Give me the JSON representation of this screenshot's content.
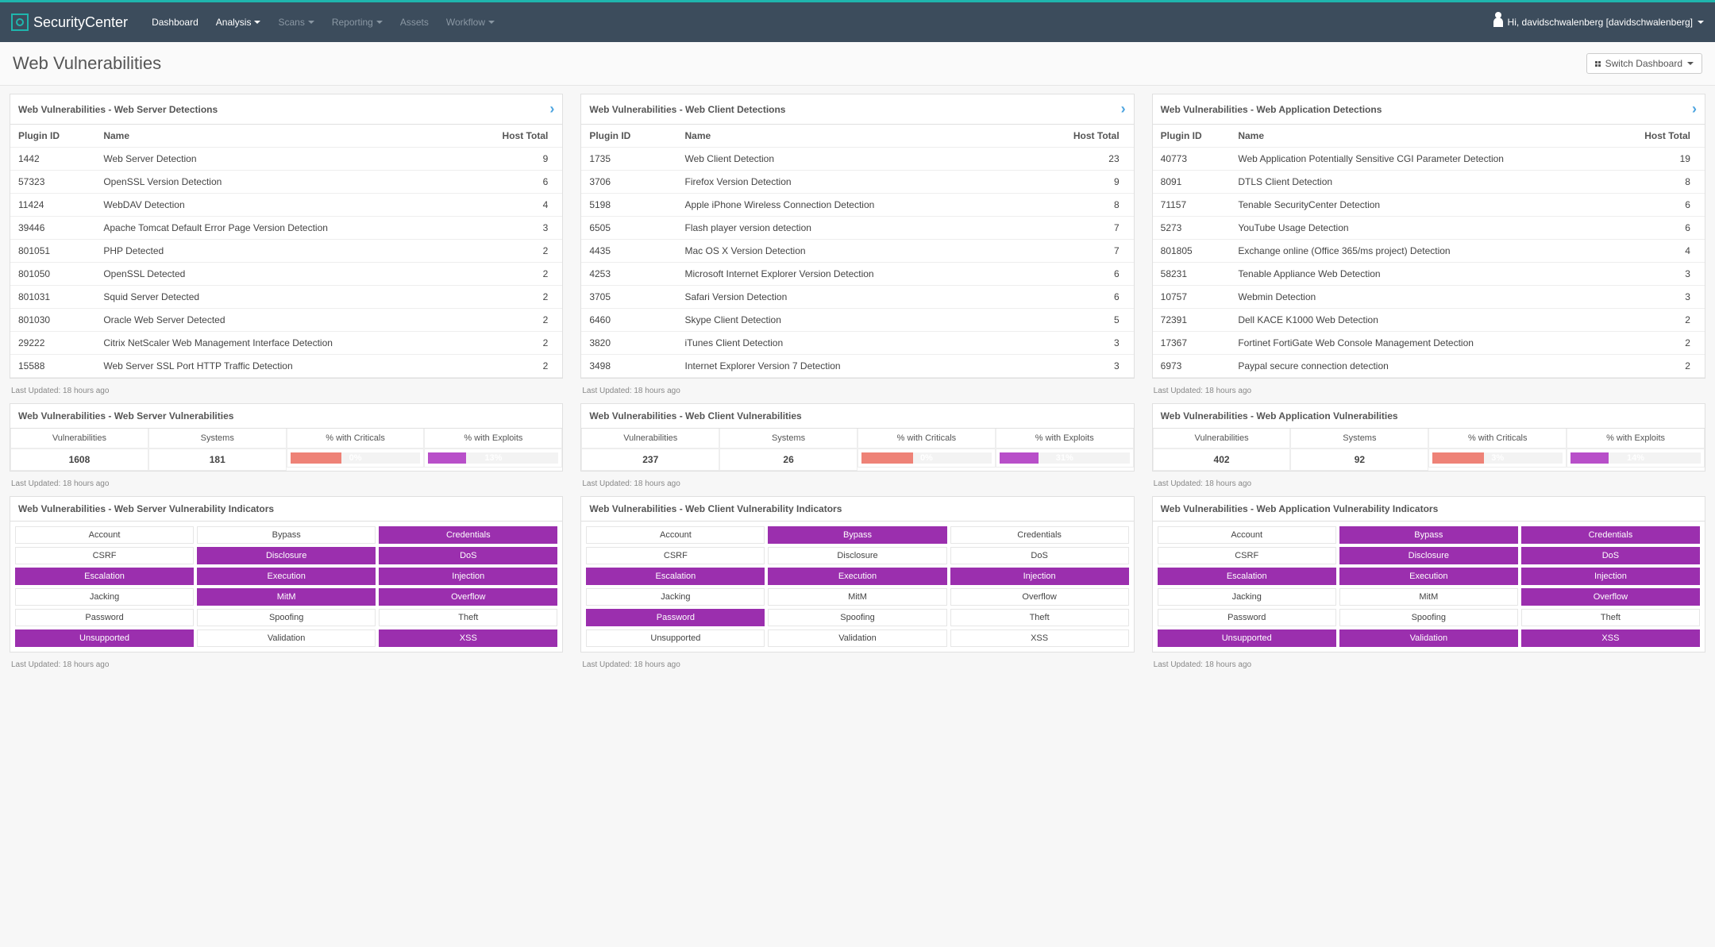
{
  "brand": "SecurityCenter",
  "nav": [
    {
      "label": "Dashboard",
      "active": true,
      "caret": false
    },
    {
      "label": "Analysis",
      "active": true,
      "caret": true
    },
    {
      "label": "Scans",
      "active": false,
      "caret": true
    },
    {
      "label": "Reporting",
      "active": false,
      "caret": true
    },
    {
      "label": "Assets",
      "active": false,
      "caret": false
    },
    {
      "label": "Workflow",
      "active": false,
      "caret": true
    }
  ],
  "user_greeting": "Hi, davidschwalenberg [davidschwalenberg]",
  "page_title": "Web Vulnerabilities",
  "switch_label": "Switch Dashboard",
  "updated_text": "Last Updated: 18 hours ago",
  "table_headers": {
    "plugin": "Plugin ID",
    "name": "Name",
    "host": "Host Total"
  },
  "detections": [
    {
      "title": "Web Vulnerabilities - Web Server Detections",
      "rows": [
        {
          "id": "1442",
          "name": "Web Server Detection",
          "total": "9"
        },
        {
          "id": "57323",
          "name": "OpenSSL Version Detection",
          "total": "6"
        },
        {
          "id": "11424",
          "name": "WebDAV Detection",
          "total": "4"
        },
        {
          "id": "39446",
          "name": "Apache Tomcat Default Error Page Version Detection",
          "total": "3"
        },
        {
          "id": "801051",
          "name": "PHP Detected",
          "total": "2"
        },
        {
          "id": "801050",
          "name": "OpenSSL Detected",
          "total": "2"
        },
        {
          "id": "801031",
          "name": "Squid Server Detected",
          "total": "2"
        },
        {
          "id": "801030",
          "name": "Oracle Web Server Detected",
          "total": "2"
        },
        {
          "id": "29222",
          "name": "Citrix NetScaler Web Management Interface Detection",
          "total": "2"
        },
        {
          "id": "15588",
          "name": "Web Server SSL Port HTTP Traffic Detection",
          "total": "2"
        }
      ]
    },
    {
      "title": "Web Vulnerabilities - Web Client Detections",
      "rows": [
        {
          "id": "1735",
          "name": "Web Client Detection",
          "total": "23"
        },
        {
          "id": "3706",
          "name": "Firefox Version Detection",
          "total": "9"
        },
        {
          "id": "5198",
          "name": "Apple iPhone Wireless Connection Detection",
          "total": "8"
        },
        {
          "id": "6505",
          "name": "Flash player version detection",
          "total": "7"
        },
        {
          "id": "4435",
          "name": "Mac OS X Version Detection",
          "total": "7"
        },
        {
          "id": "4253",
          "name": "Microsoft Internet Explorer Version Detection",
          "total": "6"
        },
        {
          "id": "3705",
          "name": "Safari Version Detection",
          "total": "6"
        },
        {
          "id": "6460",
          "name": "Skype Client Detection",
          "total": "5"
        },
        {
          "id": "3820",
          "name": "iTunes Client Detection",
          "total": "3"
        },
        {
          "id": "3498",
          "name": "Internet Explorer Version 7 Detection",
          "total": "3"
        }
      ]
    },
    {
      "title": "Web Vulnerabilities - Web Application Detections",
      "rows": [
        {
          "id": "40773",
          "name": "Web Application Potentially Sensitive CGI Parameter Detection",
          "total": "19"
        },
        {
          "id": "8091",
          "name": "DTLS Client Detection",
          "total": "8"
        },
        {
          "id": "71157",
          "name": "Tenable SecurityCenter Detection",
          "total": "6"
        },
        {
          "id": "5273",
          "name": "YouTube Usage Detection",
          "total": "6"
        },
        {
          "id": "801805",
          "name": "Exchange online (Office 365/ms project) Detection",
          "total": "4"
        },
        {
          "id": "58231",
          "name": "Tenable Appliance Web Detection",
          "total": "3"
        },
        {
          "id": "10757",
          "name": "Webmin Detection",
          "total": "3"
        },
        {
          "id": "72391",
          "name": "Dell KACE K1000 Web Detection",
          "total": "2"
        },
        {
          "id": "17367",
          "name": "Fortinet FortiGate Web Console Management Detection",
          "total": "2"
        },
        {
          "id": "6973",
          "name": "Paypal secure connection detection",
          "total": "2"
        }
      ]
    }
  ],
  "vuln_headers": [
    "Vulnerabilities",
    "Systems",
    "% with Criticals",
    "% with Exploits"
  ],
  "vulns": [
    {
      "title": "Web Vulnerabilities - Web Server Vulnerabilities",
      "vulns": "1608",
      "systems": "181",
      "crit_pct": 0,
      "crit_label": "0%",
      "exp_pct": 13,
      "exp_label": "13%"
    },
    {
      "title": "Web Vulnerabilities - Web Client Vulnerabilities",
      "vulns": "237",
      "systems": "26",
      "crit_pct": 0,
      "crit_label": "0%",
      "exp_pct": 31,
      "exp_label": "31%"
    },
    {
      "title": "Web Vulnerabilities - Web Application Vulnerabilities",
      "vulns": "402",
      "systems": "92",
      "crit_pct": 3,
      "crit_label": "3%",
      "exp_pct": 14,
      "exp_label": "14%"
    }
  ],
  "indicator_labels": [
    "Account",
    "Bypass",
    "Credentials",
    "CSRF",
    "Disclosure",
    "DoS",
    "Escalation",
    "Execution",
    "Injection",
    "Jacking",
    "MitM",
    "Overflow",
    "Password",
    "Spoofing",
    "Theft",
    "Unsupported",
    "Validation",
    "XSS"
  ],
  "indicators": [
    {
      "title": "Web Vulnerabilities - Web Server Vulnerability Indicators",
      "on": [
        2,
        4,
        5,
        6,
        7,
        8,
        10,
        11,
        15,
        17
      ]
    },
    {
      "title": "Web Vulnerabilities - Web Client Vulnerability Indicators",
      "on": [
        1,
        6,
        7,
        8,
        12
      ]
    },
    {
      "title": "Web Vulnerabilities - Web Application Vulnerability Indicators",
      "on": [
        1,
        2,
        4,
        5,
        6,
        7,
        8,
        11,
        15,
        16,
        17
      ]
    }
  ],
  "colors": {
    "crit": "#ee8277",
    "exp": "#b84fc9",
    "ind": "#9b2fae"
  }
}
